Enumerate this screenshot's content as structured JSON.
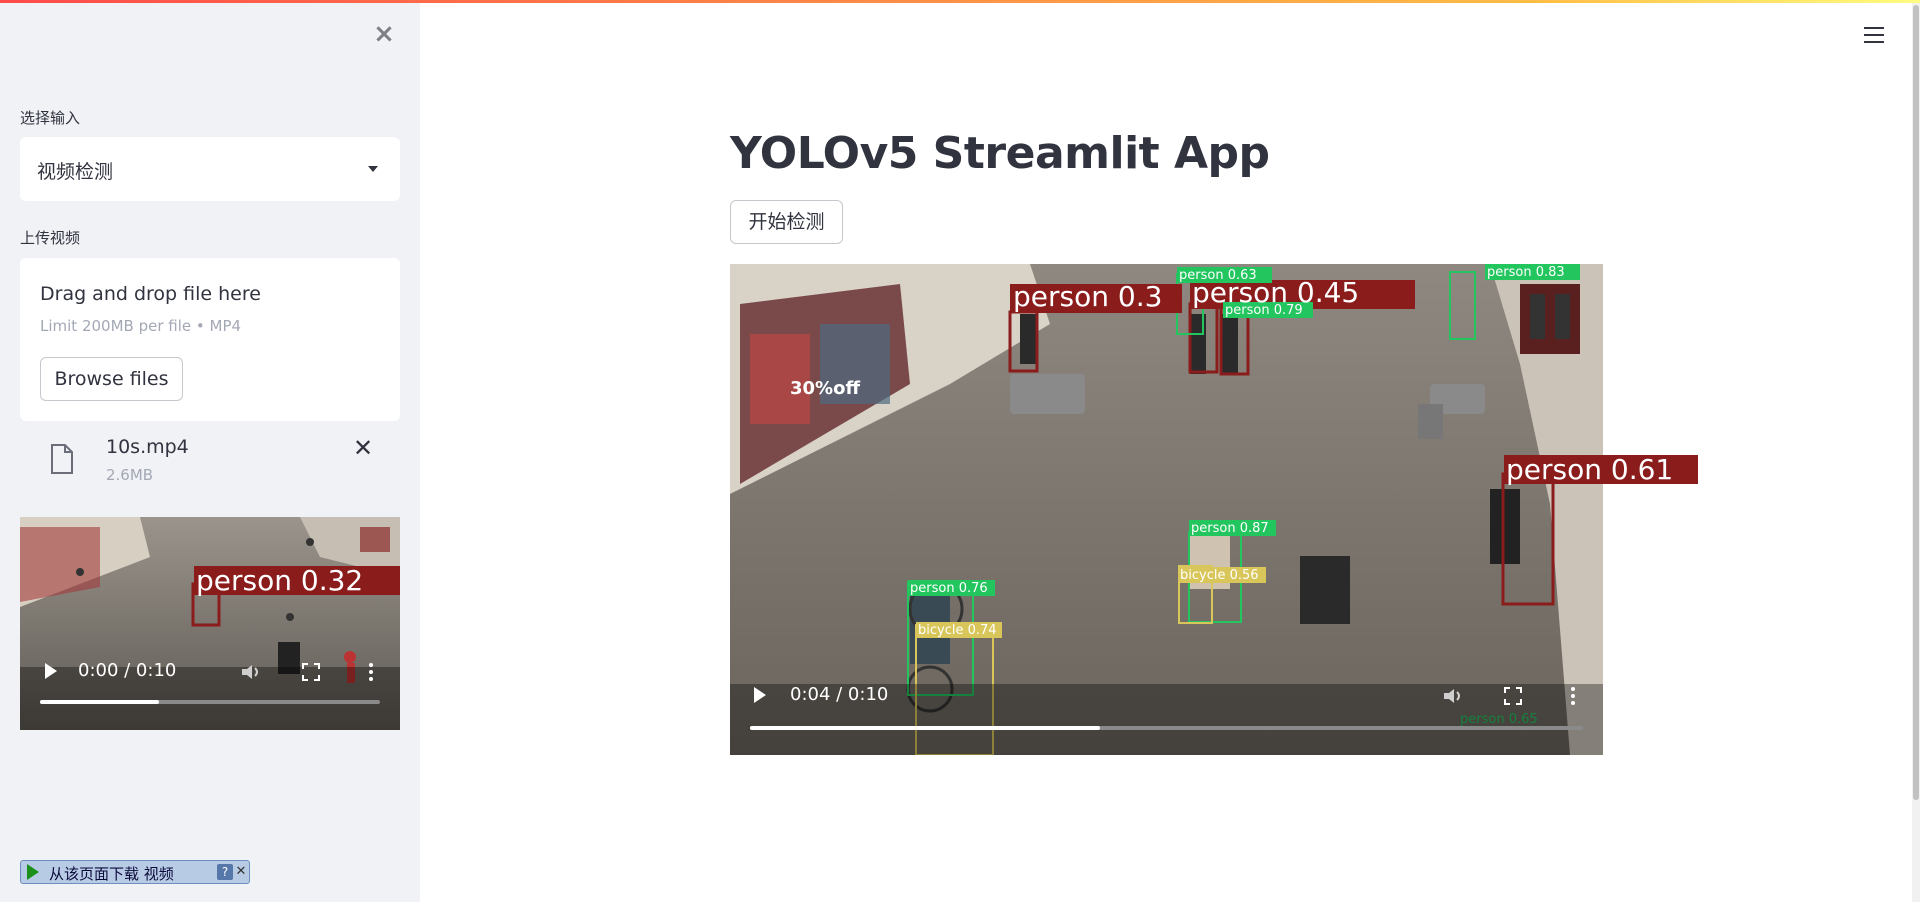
{
  "sidebar": {
    "input_label": "选择输入",
    "input_value": "视频检测",
    "upload_label": "上传视频",
    "uploader": {
      "drag_text": "Drag and drop file here",
      "limit_text": "Limit 200MB per file • MP4",
      "browse_label": "Browse files"
    },
    "file": {
      "name": "10s.mp4",
      "size": "2.6MB"
    },
    "video": {
      "time": "0:00 / 0:10",
      "progress": 0.35,
      "detection_label": "person  0.32"
    },
    "download_bar": {
      "text": "从该页面下载 视频",
      "help": "?",
      "close": "✕"
    }
  },
  "main": {
    "title": "YOLOv5 Streamlit App",
    "start_button": "开始检测",
    "video": {
      "time": "0:04 / 0:10",
      "progress": 0.42,
      "detections": [
        "person  0.3",
        "person  0.45",
        "person 0.63",
        "person 0.79",
        "person 0.83",
        "person  0.61",
        "person 0.87",
        "bicycle 0.56",
        "person 0.76",
        "bicycle 0.74",
        "person 0.65"
      ]
    }
  },
  "colors": {
    "accent_gradient_start": "#ff4b4b",
    "sidebar_bg": "#f0f2f6",
    "text": "#31333f",
    "detection_red": "#8b1c1c",
    "detection_green": "#22c55e",
    "detection_yellow": "#d9c65a"
  }
}
